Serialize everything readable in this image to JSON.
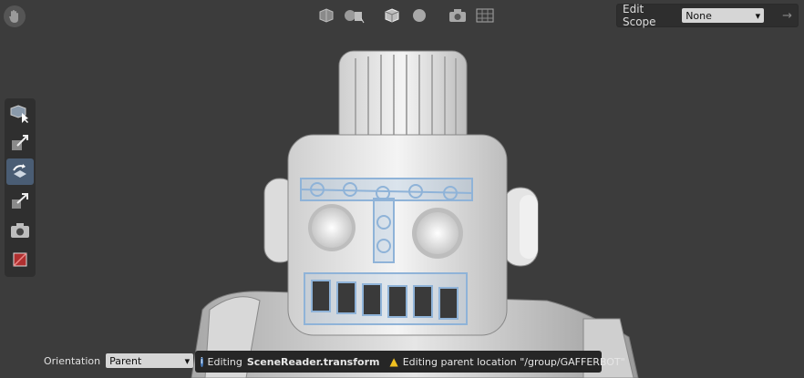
{
  "edit_scope": {
    "label": "Edit Scope",
    "value": "None"
  },
  "orientation": {
    "label": "Orientation",
    "value": "Parent"
  },
  "status": {
    "editing_prefix": "Editing",
    "editing_target": "SceneReader.transform",
    "warning_text": "Editing parent location \"/group/GAFFERBOT\""
  },
  "icons": {
    "top_toolbar": [
      "shading-mode-icon",
      "expansion-icon",
      "wireframe-icon",
      "sphere-icon",
      "camera-icon",
      "grid-icon"
    ],
    "left_tools": [
      "selection-tool-icon",
      "translate-tool-icon",
      "rotate-tool-icon",
      "scale-tool-icon",
      "camera-tool-icon",
      "crop-window-tool-icon"
    ]
  },
  "colors": {
    "selection_wire": "#8fb3d8",
    "active_tool": "#4a5d74",
    "background": "#3c3c3c"
  }
}
